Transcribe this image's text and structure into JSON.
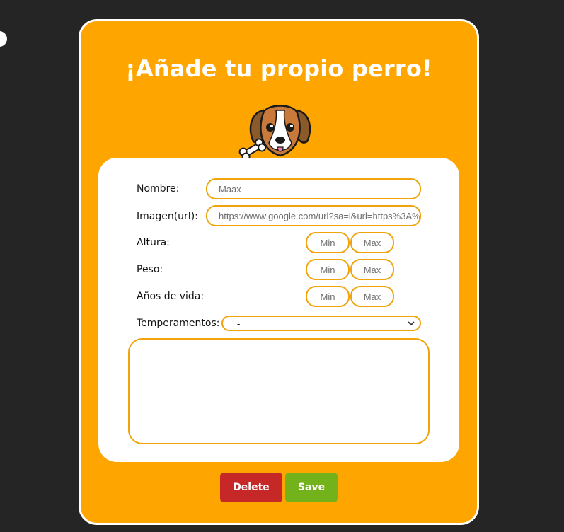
{
  "form": {
    "title": "¡Añade tu propio perro!",
    "name_label": "Nombre:",
    "name_value": "Maax",
    "image_label": "Imagen(url):",
    "image_value": "https://www.google.com/url?sa=i&url=https%3A%",
    "height_label": "Altura:",
    "weight_label": "Peso:",
    "lifespan_label": "Años de vida:",
    "min_placeholder": "Min",
    "max_placeholder": "Max",
    "temperaments_label": "Temperamentos:",
    "temperaments_selected": "-"
  },
  "actions": {
    "delete_label": "Delete",
    "save_label": "Save"
  },
  "colors": {
    "card": "#FFA500",
    "field_border": "#F0A30A",
    "delete": "#C62828",
    "save": "#74B21B",
    "background": "#252525"
  },
  "icons": [
    "beagle-mascot-icon",
    "chevron-down-icon"
  ]
}
